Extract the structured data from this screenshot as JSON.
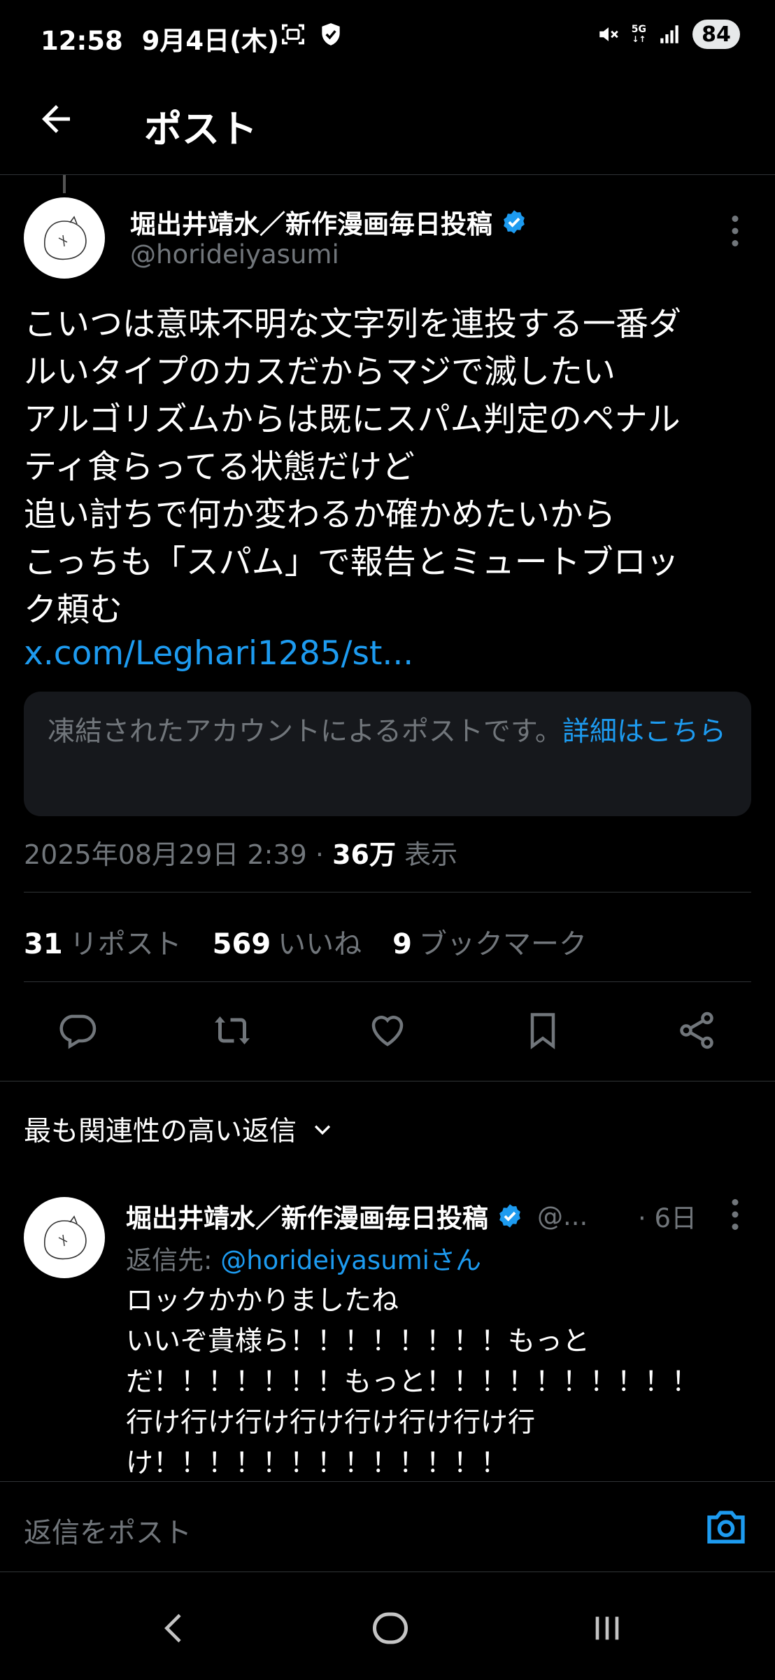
{
  "status_bar": {
    "time": "12:58",
    "date": "9月4日(木)",
    "network": "5G",
    "battery": "84"
  },
  "header": {
    "title": "ポスト"
  },
  "post": {
    "author_name": "堀出井靖水／新作漫画毎日投稿",
    "handle": "@horideiyasumi",
    "text": "こいつは意味不明な文字列を連投する一番ダ\nルいタイプのカスだからマジで滅したい\nアルゴリズムからは既にスパム判定のペナル\nティ食らってる状態だけど\n追い討ちで何か変わるか確かめたいから\nこっちも「スパム」で報告とミュートブロッ\nク頼む",
    "link": "x.com/Leghari1285/st...",
    "notice_text": "凍結されたアカウントによるポストです。",
    "notice_link": "詳細はこちら",
    "date": "2025年08月29日 2:39",
    "separator": "·",
    "views_count": "36万",
    "views_label": "表示"
  },
  "stats": {
    "reposts_count": "31",
    "reposts_label": "リポスト",
    "likes_count": "569",
    "likes_label": "いいね",
    "bookmarks_count": "9",
    "bookmarks_label": "ブックマーク"
  },
  "sort": {
    "label": "最も関連性の高い返信"
  },
  "reply": {
    "author_name": "堀出井靖水／新作漫画毎日投稿",
    "handle": "@...",
    "time": "· 6日",
    "reply_to_label": "返信先: ",
    "reply_to_handle": "@horideiyasumiさん",
    "text": "ロックかかりましたね\nいいぞ貴様ら！！！！！！！！もっと\nだ！！！！！！！もっと！！！！！！！！！！\n行け行け行け行け行け行け行け行\nけ！！！！！！！！！！！！！"
  },
  "composer": {
    "placeholder": "返信をポスト"
  },
  "colors": {
    "accent": "#1d9bf0",
    "muted": "#71767b",
    "background": "#000000",
    "card": "#16181c"
  }
}
